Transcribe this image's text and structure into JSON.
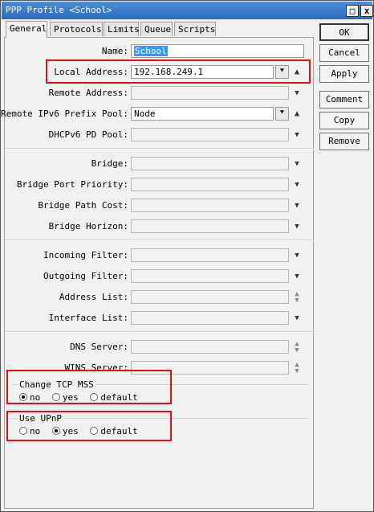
{
  "window": {
    "title": "PPP Profile <School>",
    "maximize_glyph": "□",
    "close_glyph": "x"
  },
  "tabs": [
    "General",
    "Protocols",
    "Limits",
    "Queue",
    "Scripts"
  ],
  "fields": {
    "name": {
      "label": "Name:",
      "value": "School"
    },
    "local_address": {
      "label": "Local Address:",
      "value": "192.168.249.1"
    },
    "remote_address": {
      "label": "Remote Address:",
      "value": ""
    },
    "remote_ipv6_prefix_pool": {
      "label": "Remote IPv6 Prefix Pool:",
      "value": "Node"
    },
    "dhcpv6_pd_pool": {
      "label": "DHCPv6 PD Pool:",
      "value": ""
    },
    "bridge": {
      "label": "Bridge:",
      "value": ""
    },
    "bridge_port_priority": {
      "label": "Bridge Port Priority:",
      "value": ""
    },
    "bridge_path_cost": {
      "label": "Bridge Path Cost:",
      "value": ""
    },
    "bridge_horizon": {
      "label": "Bridge Horizon:",
      "value": ""
    },
    "incoming_filter": {
      "label": "Incoming Filter:",
      "value": ""
    },
    "outgoing_filter": {
      "label": "Outgoing Filter:",
      "value": ""
    },
    "address_list": {
      "label": "Address List:",
      "value": ""
    },
    "interface_list": {
      "label": "Interface List:",
      "value": ""
    },
    "dns_server": {
      "label": "DNS Server:",
      "value": ""
    },
    "wins_server": {
      "label": "WINS Server:",
      "value": ""
    }
  },
  "icons": {
    "dropdown": "dropdown-icon",
    "up": "triangle-up-icon",
    "down": "triangle-down-icon",
    "updown": "up-down-icon"
  },
  "glyphs": {
    "dropdown": "⯆",
    "up": "▲",
    "down": "▼",
    "updown": "▲\n▼"
  },
  "change_tcp_mss": {
    "title": "Change TCP MSS",
    "options": [
      "no",
      "yes",
      "default"
    ],
    "selected": "no"
  },
  "use_upnp": {
    "title": "Use UPnP",
    "options": [
      "no",
      "yes",
      "default"
    ],
    "selected": "yes"
  },
  "buttons": {
    "ok": "OK",
    "cancel": "Cancel",
    "apply": "Apply",
    "comment": "Comment",
    "copy": "Copy",
    "remove": "Remove"
  },
  "colors": {
    "highlight": "#e0101a",
    "title_bar": "#2a6bbf",
    "selection": "#3399ff"
  }
}
